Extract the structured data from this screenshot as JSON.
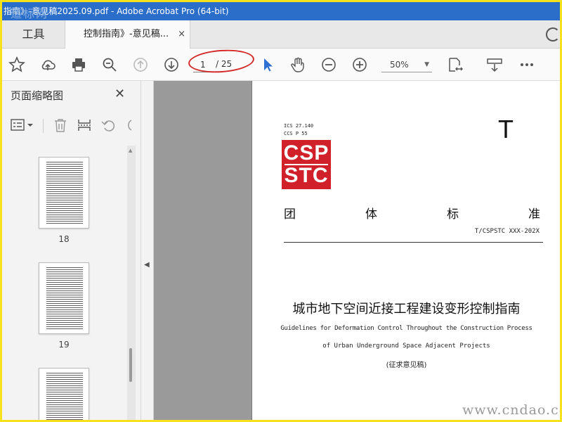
{
  "window": {
    "title": "指南》-意见稿2025.09.pdf - Adobe Acrobat Pro (64-bit)",
    "watermark_top": "道标网"
  },
  "tabs": {
    "tools_label": "工具",
    "doc_label": "控制指南》-意见稿...",
    "close_glyph": "×"
  },
  "toolbar": {
    "page_current": "1",
    "page_total": "/ 25",
    "zoom": "50%",
    "zoom_caret": "▼",
    "icons": [
      "star-icon",
      "cloud-upload-icon",
      "print-icon",
      "search-icon",
      "page-up-icon",
      "page-down-icon",
      "select-arrow-icon",
      "hand-icon",
      "zoom-out-icon",
      "zoom-in-icon",
      "fit-page-icon",
      "scroll-mode-icon",
      "more-icon"
    ],
    "highlight_color": "#d42a2a"
  },
  "sidebar": {
    "title": "页面缩略图",
    "close_glyph": "✕",
    "thumbnails": [
      {
        "label": "18"
      },
      {
        "label": "19"
      },
      {
        "label": ""
      }
    ]
  },
  "document": {
    "ics_line1": "ICS 27.140",
    "ics_line2": "CCS P 55",
    "big_letter": "T",
    "logo_line1": "CSP",
    "logo_line2": "STC",
    "logo_color": "#d0202a",
    "std_chars": [
      "团",
      "体",
      "标",
      "准"
    ],
    "std_number": "T/CSPSTC XXX-202X",
    "title_cn": "城市地下空间近接工程建设变形控制指南",
    "title_en1": "Guidelines for Deformation Control Throughout the Construction Process",
    "title_en2": "of Urban Underground Space Adjacent Projects",
    "draft_label": "(征求意见稿)"
  },
  "watermark_bottom": "www.cndao.com"
}
